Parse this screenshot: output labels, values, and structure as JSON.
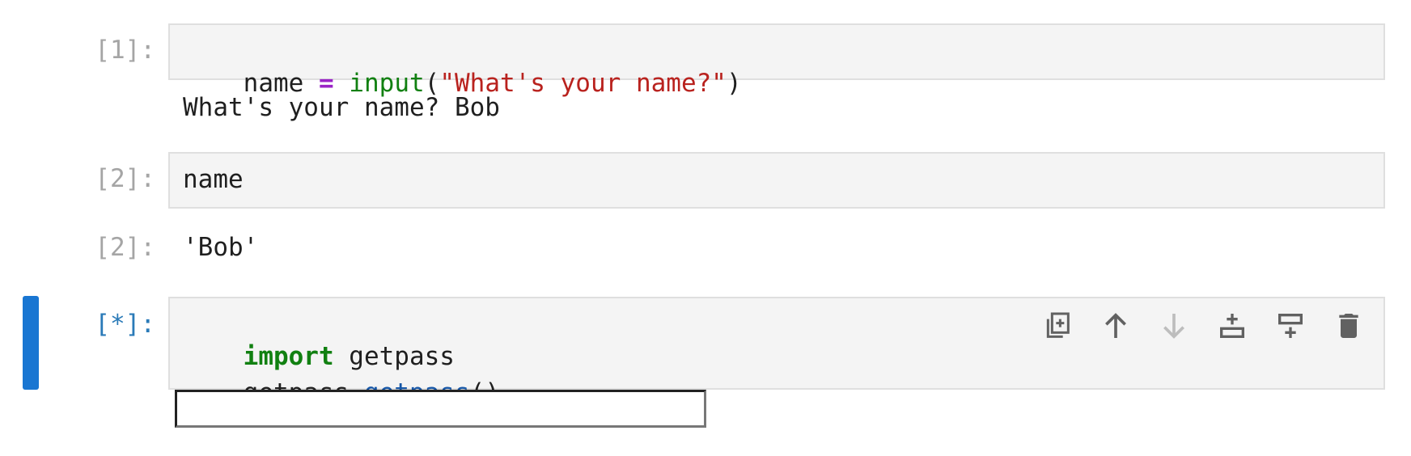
{
  "cells": [
    {
      "input_prompt": "[1]:",
      "code_tokens": [
        {
          "text": "name ",
          "kind": "plain"
        },
        {
          "text": "=",
          "kind": "op"
        },
        {
          "text": " ",
          "kind": "plain"
        },
        {
          "text": "input",
          "kind": "builtin"
        },
        {
          "text": "(",
          "kind": "plain"
        },
        {
          "text": "\"What's your name?\"",
          "kind": "string"
        },
        {
          "text": ")",
          "kind": "plain"
        }
      ],
      "stream_output": "What's your name? Bob"
    },
    {
      "input_prompt": "[2]:",
      "code_text": "name",
      "output_prompt": "[2]:",
      "result": "'Bob'"
    },
    {
      "input_prompt": "[*]:",
      "line1_keyword": "import",
      "line1_rest": " getpass",
      "line2_obj": "getpass.",
      "line2_attr": "getpass",
      "line2_parens": "()",
      "password_value": ""
    }
  ],
  "toolbar_icons": [
    "duplicate-icon",
    "move-up-icon",
    "move-down-icon",
    "insert-below-icon",
    "insert-above-icon",
    "delete-icon"
  ],
  "colors": {
    "active_bar": "#1976d2",
    "keyword": "#118011",
    "operator": "#9a23c7",
    "string": "#b9221e",
    "attribute": "#1656a6"
  }
}
